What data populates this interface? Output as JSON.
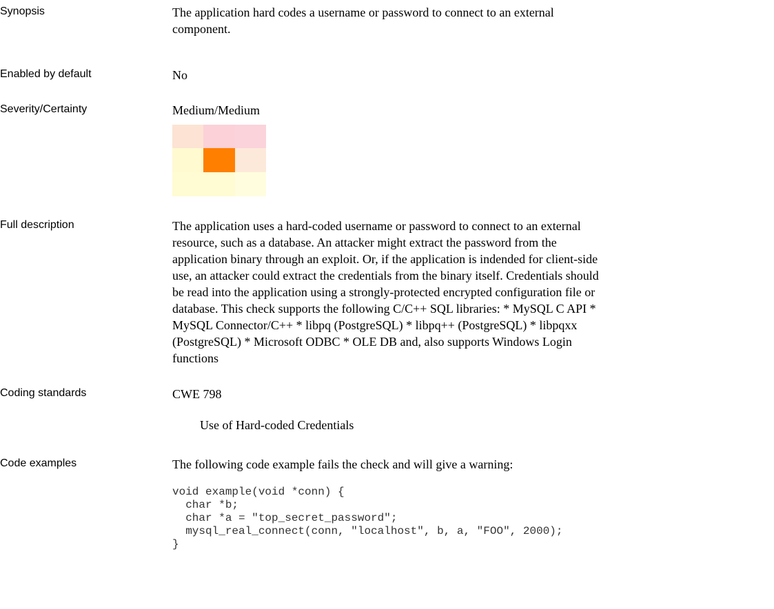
{
  "synopsis": {
    "label": "Synopsis",
    "text": "The application hard codes a username or password to connect to an external component."
  },
  "enabled_by_default": {
    "label": "Enabled by default",
    "value": "No"
  },
  "severity_certainty": {
    "label": "Severity/Certainty",
    "value": "Medium/Medium",
    "matrix_colors": [
      "#fde3d3",
      "#fcd1d7",
      "#fbd3da",
      "#fffad0",
      "#ff7f00",
      "#fde9da",
      "#fffbd2",
      "#fffbd3",
      "#fffdde"
    ]
  },
  "full_description": {
    "label": "Full description",
    "text": "The application uses a hard-coded username or password to connect to an external resource, such as a database. An attacker might extract the password from the application binary through an exploit. Or, if the application is indended for client-side use, an attacker could extract the credentials from the binary itself.  Credentials should be read into the application using a strongly-protected encrypted configuration file or database.  This check supports the following C/C++ SQL libraries:  * MySQL C API  * MySQL Connector/C++  * libpq (PostgreSQL)  * libpq++ (PostgreSQL)  * libpqxx (PostgreSQL)  * Microsoft ODBC  * OLE DB  and, also supports Windows Login functions"
  },
  "coding_standards": {
    "label": "Coding standards",
    "standard": "CWE 798",
    "standard_title": "Use of Hard-coded Credentials"
  },
  "code_examples": {
    "label": "Code examples",
    "intro": "The following code example fails the check and will give a warning:",
    "code": "void example(void *conn) {\n  char *b;\n  char *a = \"top_secret_password\";\n  mysql_real_connect(conn, \"localhost\", b, a, \"FOO\", 2000);\n}"
  }
}
